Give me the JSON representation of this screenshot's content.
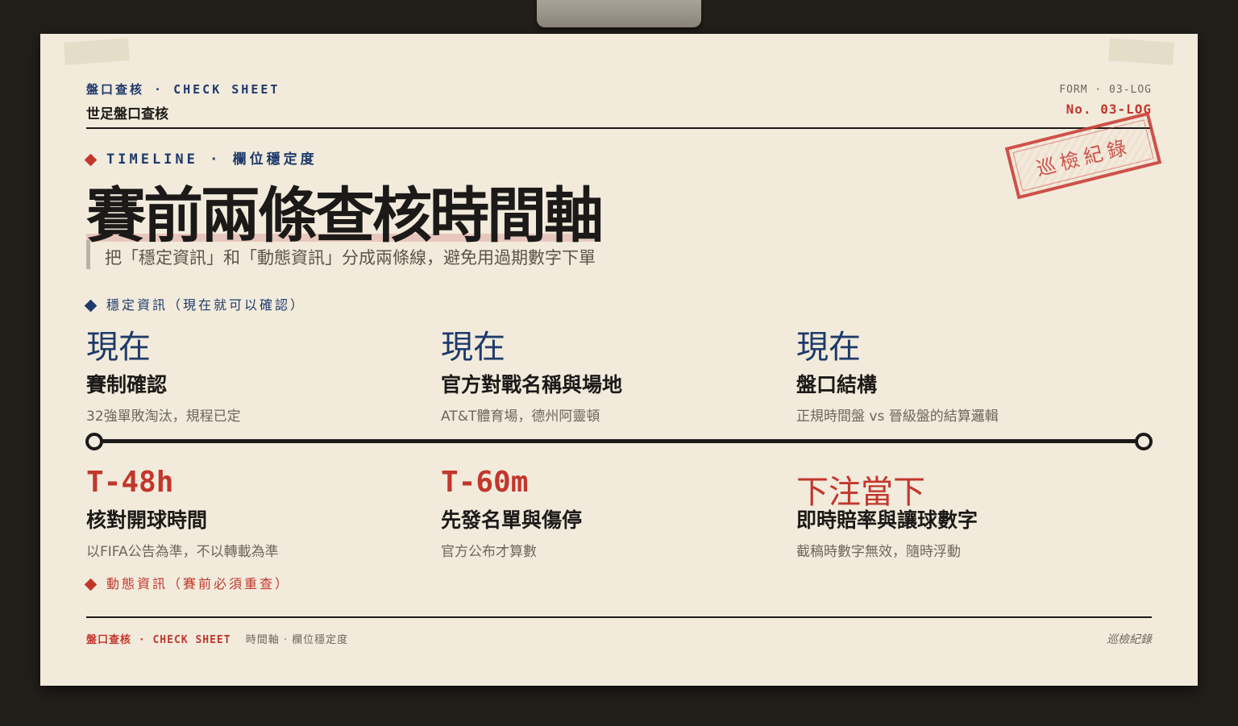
{
  "header": {
    "series": "盤口查核 · CHECK SHEET",
    "title": "世足盤口查核",
    "form": "FORM · 03-LOG",
    "number": "No. 03-LOG"
  },
  "stamp": "巡檢紀錄",
  "section": {
    "kicker": "TIMELINE · 欄位穩定度",
    "headline": "賽前兩條查核時間軸",
    "subtitle": "把「穩定資訊」和「動態資訊」分成兩條線，避免用過期數字下單"
  },
  "stable": {
    "label": "穩定資訊（現在就可以確認）",
    "items": [
      {
        "time": "現在",
        "title": "賽制確認",
        "desc": "32強單敗淘汰，規程已定"
      },
      {
        "time": "現在",
        "title": "官方對戰名稱與場地",
        "desc": "AT&T體育場，德州阿靈頓"
      },
      {
        "time": "現在",
        "title": "盤口結構",
        "desc": "正規時間盤 vs 晉級盤的結算邏輯"
      }
    ]
  },
  "dynamic": {
    "label": "動態資訊（賽前必須重查）",
    "items": [
      {
        "time": "T-48h",
        "title": "核對開球時間",
        "desc": "以FIFA公告為準，不以轉載為準"
      },
      {
        "time": "T-60m",
        "title": "先發名單與傷停",
        "desc": "官方公布才算數"
      },
      {
        "time": "下注當下",
        "title": "即時賠率與讓球數字",
        "desc": "截稿時數字無效，隨時浮動"
      }
    ]
  },
  "footer": {
    "series": "盤口查核 · CHECK SHEET",
    "section": "時間軸 · 欄位穩定度",
    "sign": "巡檢紀錄"
  },
  "colors": {
    "navy": "#1e3a6a",
    "red": "#c2372c",
    "ink": "#1c1a18",
    "paper": "#f2ebdc"
  }
}
